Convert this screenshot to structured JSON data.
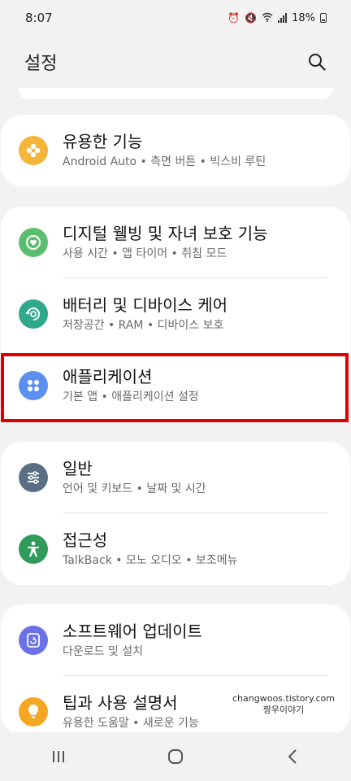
{
  "status": {
    "time": "8:07",
    "battery": "18%"
  },
  "header": {
    "title": "설정"
  },
  "groups": [
    {
      "items": [
        {
          "title": "유용한 기능",
          "subtitle": "Android Auto  •  측면 버튼  •  빅스비 루틴",
          "icon": "flower-icon",
          "color": "#f5b43a"
        }
      ]
    },
    {
      "items": [
        {
          "title": "디지털 웰빙 및 자녀 보호 기능",
          "subtitle": "사용 시간  •  앱 타이머  •  취침 모드",
          "icon": "heart-circle-icon",
          "color": "#5bbd6e"
        },
        {
          "title": "배터리 및 디바이스 케어",
          "subtitle": "저장공간  •  RAM  •  디바이스 보호",
          "icon": "device-care-icon",
          "color": "#2fa88c"
        },
        {
          "title": "애플리케이션",
          "subtitle": "기본 앱  •  애플리케이션 설정",
          "icon": "apps-grid-icon",
          "color": "#5b8ff0"
        }
      ]
    },
    {
      "items": [
        {
          "title": "일반",
          "subtitle": "언어 및 키보드  •  날짜 및 시간",
          "icon": "sliders-icon",
          "color": "#5a6e84"
        },
        {
          "title": "접근성",
          "subtitle": "TalkBack  •  모노 오디오  •  보조메뉴",
          "icon": "accessibility-icon",
          "color": "#2f9a5a"
        }
      ]
    },
    {
      "items": [
        {
          "title": "소프트웨어 업데이트",
          "subtitle": "다운로드 및 설치",
          "icon": "update-icon",
          "color": "#6b72e8"
        },
        {
          "title": "팁과 사용 설명서",
          "subtitle": "유용한 도움말  •  새로운 기능",
          "icon": "lightbulb-icon",
          "color": "#f5a623"
        }
      ]
    }
  ],
  "watermark": {
    "line1": "changwoos.tistory.com",
    "line2": "짱우이야기"
  }
}
